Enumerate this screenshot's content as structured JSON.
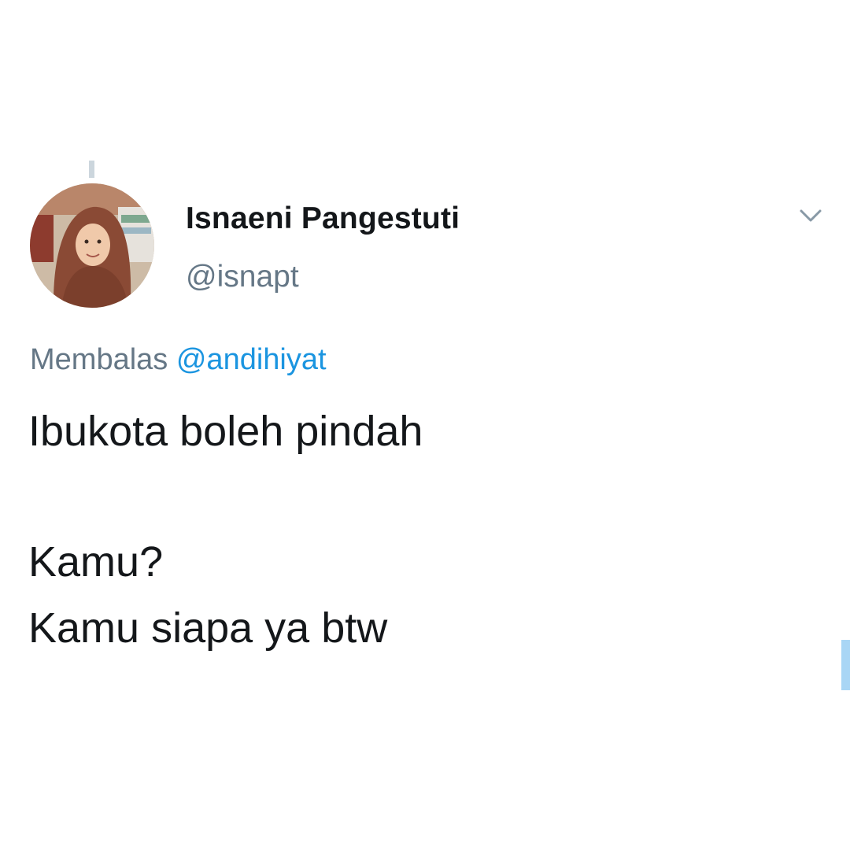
{
  "tweet": {
    "author": {
      "display_name": "Isnaeni Pangestuti",
      "handle": "@isnapt",
      "avatar_icon": "profile-photo"
    },
    "menu_icon": "chevron-down-icon",
    "reply_context": {
      "prefix": "Membalas",
      "mention": "@andihiyat"
    },
    "text_lines": [
      "Ibukota boleh pindah",
      "Kamu?",
      "Kamu siapa ya btw"
    ]
  },
  "colors": {
    "name": "#14171a",
    "secondary": "#657786",
    "link": "#1b95e0",
    "thread_line": "#ccd6dd",
    "scroll_indicator": "#a9d6f5"
  }
}
